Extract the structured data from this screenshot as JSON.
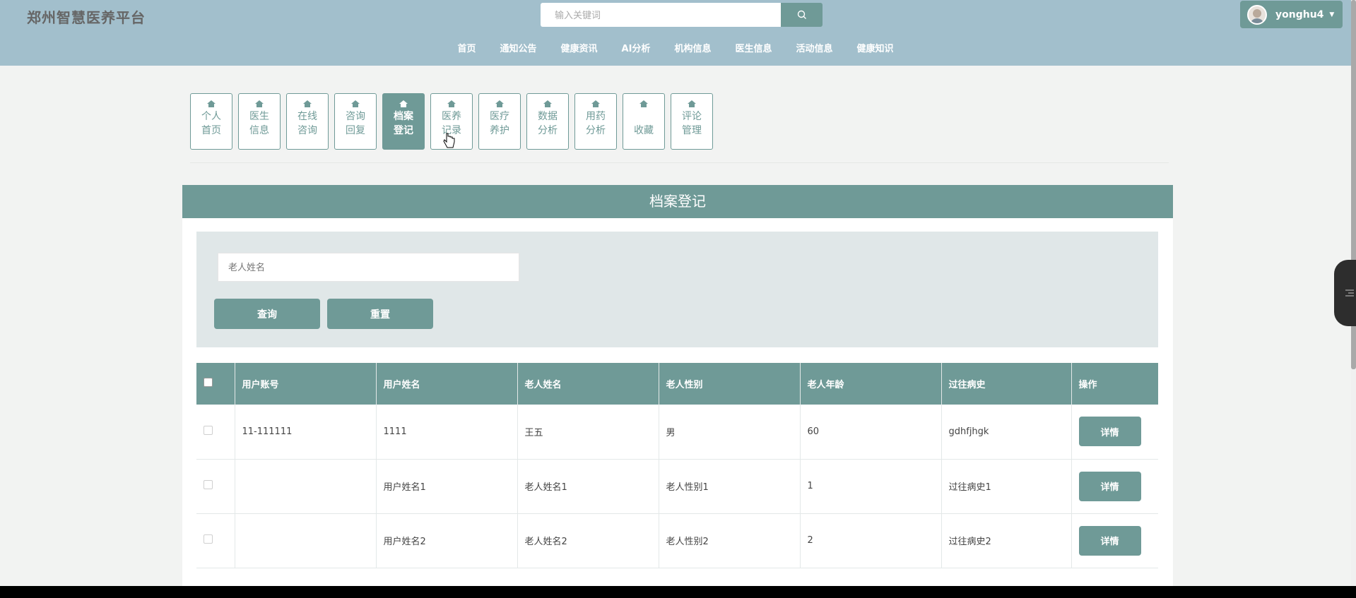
{
  "header": {
    "brand": "郑州智慧医养平台",
    "search_placeholder": "输入关键词",
    "username": "yonghu4",
    "nav": [
      "首页",
      "通知公告",
      "健康资讯",
      "AI分析",
      "机构信息",
      "医生信息",
      "活动信息",
      "健康知识"
    ]
  },
  "tiles": [
    {
      "line1": "个人",
      "line2": "首页",
      "active": false
    },
    {
      "line1": "医生",
      "line2": "信息",
      "active": false
    },
    {
      "line1": "在线",
      "line2": "咨询",
      "active": false
    },
    {
      "line1": "咨询",
      "line2": "回复",
      "active": false
    },
    {
      "line1": "档案",
      "line2": "登记",
      "active": true
    },
    {
      "line1": "医养",
      "line2": "记录",
      "active": false
    },
    {
      "line1": "医疗",
      "line2": "养护",
      "active": false
    },
    {
      "line1": "数据",
      "line2": "分析",
      "active": false
    },
    {
      "line1": "用药",
      "line2": "分析",
      "active": false
    },
    {
      "line1": "",
      "line2": "收藏",
      "active": false
    },
    {
      "line1": "评论",
      "line2": "管理",
      "active": false
    }
  ],
  "panel": {
    "title": "档案登记",
    "filter_placeholder": "老人姓名",
    "query_label": "查询",
    "reset_label": "重置"
  },
  "table": {
    "columns": [
      "用户账号",
      "用户姓名",
      "老人姓名",
      "老人性别",
      "老人年龄",
      "过往病史",
      "操作"
    ],
    "rows": [
      [
        "11-111111",
        "1111",
        "王五",
        "男",
        "60",
        "gdhfjhgk"
      ],
      [
        "",
        "用户姓名1",
        "老人姓名1",
        "老人性别1",
        "1",
        "过往病史1"
      ],
      [
        "",
        "用户姓名2",
        "老人姓名2",
        "老人性别2",
        "2",
        "过往病史2"
      ]
    ],
    "action_label": "详情"
  },
  "colors": {
    "header_bg": "#a2bfcc",
    "accent": "#6f9a97",
    "filter_bg": "#e0e7e8"
  },
  "icons": [
    "search-icon",
    "home-icon",
    "caret-down-icon",
    "list-icon"
  ]
}
